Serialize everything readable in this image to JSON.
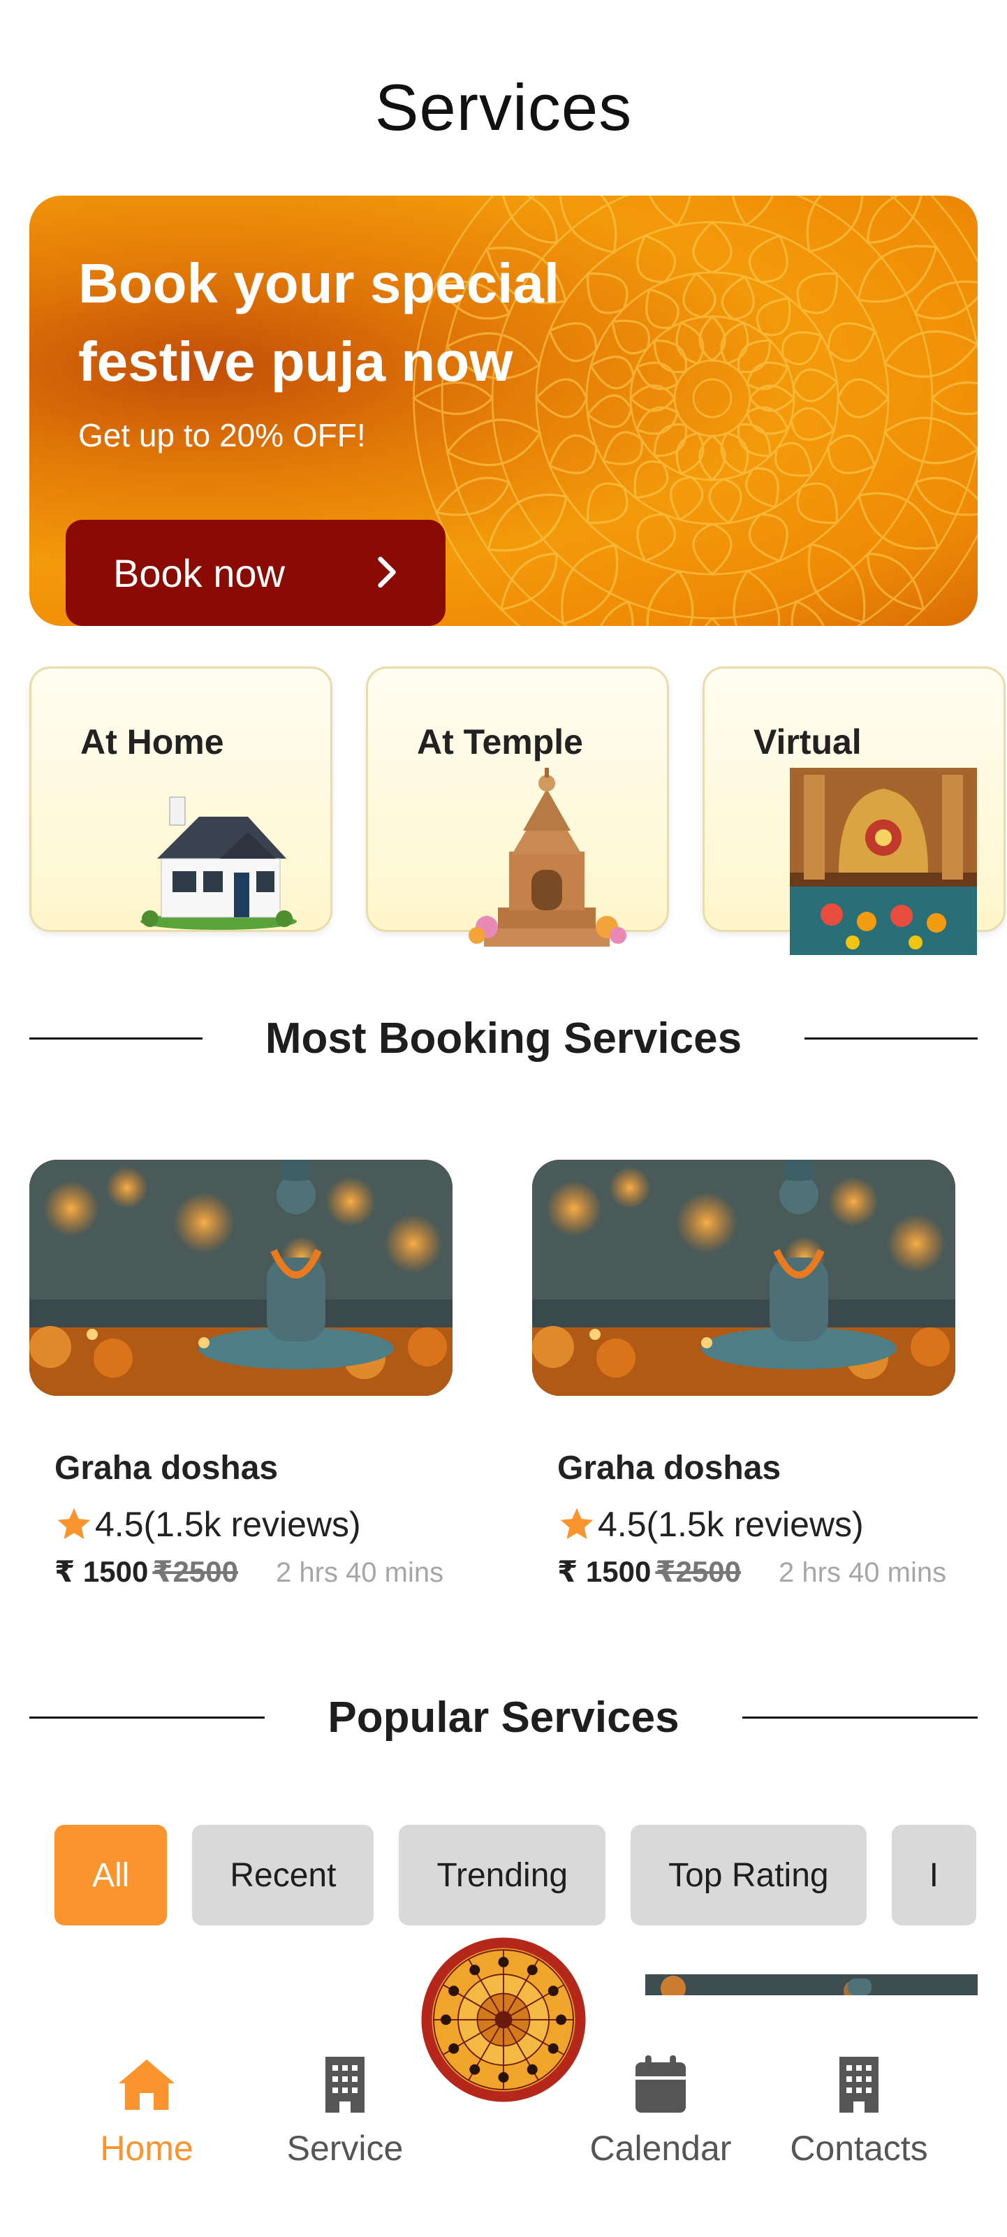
{
  "page": {
    "title": "Services"
  },
  "banner": {
    "heading_line1": "Book your special",
    "heading_line2": "festive puja now",
    "subtext": "Get up to 20% OFF!",
    "button_label": "Book now",
    "colors": {
      "button": "#8a0b04",
      "gradient_start": "#c24e08",
      "gradient_end": "#f39a0b"
    }
  },
  "categories": [
    {
      "label": "At Home",
      "icon": "house-image"
    },
    {
      "label": "At Temple",
      "icon": "temple-image"
    },
    {
      "label": "Virtual",
      "icon": "puja-altar-image"
    }
  ],
  "most_booking": {
    "heading": "Most Booking Services",
    "items": [
      {
        "name": "Graha doshas",
        "rating": "4.5",
        "reviews": "(1.5k reviews)",
        "currency": "₹",
        "price": "1500",
        "old_price": "₹2500",
        "duration": "2 hrs 40 mins"
      },
      {
        "name": "Graha doshas",
        "rating": "4.5",
        "reviews": "(1.5k reviews)",
        "currency": "₹",
        "price": "1500",
        "old_price": "₹2500",
        "duration": "2 hrs 40 mins"
      }
    ]
  },
  "popular": {
    "heading": "Popular Services",
    "filters": [
      {
        "label": "All",
        "active": true
      },
      {
        "label": "Recent",
        "active": false
      },
      {
        "label": "Trending",
        "active": false
      },
      {
        "label": "Top Rating",
        "active": false
      },
      {
        "label": "I",
        "active": false
      }
    ]
  },
  "bottom_nav": {
    "items": [
      {
        "label": "Home",
        "icon": "home-icon",
        "active": true
      },
      {
        "label": "Service",
        "icon": "building-icon",
        "active": false
      },
      {
        "label": "Calendar",
        "icon": "calendar-icon",
        "active": false
      },
      {
        "label": "Contacts",
        "icon": "building-icon",
        "active": false
      }
    ],
    "center_icon": "zodiac-wheel-icon"
  },
  "colors": {
    "accent": "#f9942f",
    "chip_inactive": "#d9d9d9",
    "card_bg": "#fff6cc"
  }
}
